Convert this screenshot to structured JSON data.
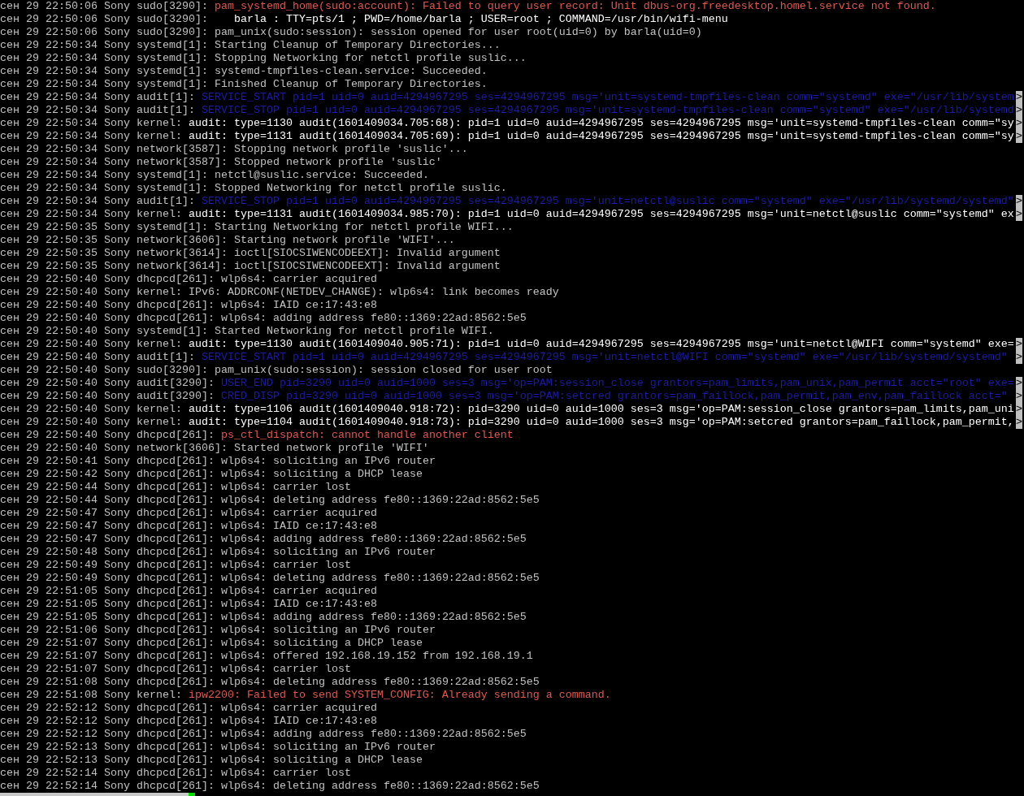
{
  "lines": [
    {
      "prefix": "сен 29 22:50:06 Sony sudo[3290]:",
      "message": "pam_systemd_home(sudo:account): Failed to query user record: Unit dbus-org.freedesktop.homel.service not found.",
      "kind": "error"
    },
    {
      "prefix": "сен 29 22:50:06 Sony sudo[3290]:",
      "message": "   barla : TTY=pts/1 ; PWD=/home/barla ; USER=root ; COMMAND=/usr/bin/wifi-menu",
      "kind": "notice"
    },
    {
      "prefix": "сен 29 22:50:06 Sony sudo[3290]:",
      "message": "pam_unix(sudo:session): session opened for user root(uid=0) by barla(uid=0)",
      "kind": "plain"
    },
    {
      "prefix": "сен 29 22:50:34 Sony systemd[1]:",
      "message": "Starting Cleanup of Temporary Directories...",
      "kind": "plain"
    },
    {
      "prefix": "сен 29 22:50:34 Sony systemd[1]:",
      "message": "Stopping Networking for netctl profile suslic...",
      "kind": "plain"
    },
    {
      "prefix": "сен 29 22:50:34 Sony systemd[1]:",
      "message": "systemd-tmpfiles-clean.service: Succeeded.",
      "kind": "plain"
    },
    {
      "prefix": "сен 29 22:50:34 Sony systemd[1]:",
      "message": "Finished Cleanup of Temporary Directories.",
      "kind": "plain"
    },
    {
      "prefix": "сен 29 22:50:34 Sony audit[1]:",
      "message": "SERVICE_START pid=1 uid=0 auid=4294967295 ses=4294967295 msg='unit=systemd-tmpfiles-clean comm=\"systemd\" exe=\"/usr/lib/system",
      "kind": "audit",
      "overflow": ">"
    },
    {
      "prefix": "сен 29 22:50:34 Sony audit[1]:",
      "message": "SERVICE_STOP pid=1 uid=0 auid=4294967295 ses=4294967295 msg='unit=systemd-tmpfiles-clean comm=\"systemd\" exe=\"/usr/lib/systemd",
      "kind": "audit",
      "overflow": ">"
    },
    {
      "prefix": "сен 29 22:50:34 Sony kernel:",
      "message": "audit: type=1130 audit(1601409034.705:68): pid=1 uid=0 auid=4294967295 ses=4294967295 msg='unit=systemd-tmpfiles-clean comm=\"sy",
      "kind": "notice",
      "overflow": ">"
    },
    {
      "prefix": "сен 29 22:50:34 Sony kernel:",
      "message": "audit: type=1131 audit(1601409034.705:69): pid=1 uid=0 auid=4294967295 ses=4294967295 msg='unit=systemd-tmpfiles-clean comm=\"sy",
      "kind": "notice",
      "overflow": ">"
    },
    {
      "prefix": "сен 29 22:50:34 Sony network[3587]:",
      "message": "Stopping network profile 'suslic'...",
      "kind": "plain"
    },
    {
      "prefix": "сен 29 22:50:34 Sony network[3587]:",
      "message": "Stopped network profile 'suslic'",
      "kind": "plain"
    },
    {
      "prefix": "сен 29 22:50:34 Sony systemd[1]:",
      "message": "netctl@suslic.service: Succeeded.",
      "kind": "plain"
    },
    {
      "prefix": "сен 29 22:50:34 Sony systemd[1]:",
      "message": "Stopped Networking for netctl profile suslic.",
      "kind": "plain"
    },
    {
      "prefix": "сен 29 22:50:34 Sony audit[1]:",
      "message": "SERVICE_STOP pid=1 uid=0 auid=4294967295 ses=4294967295 msg='unit=netctl@suslic comm=\"systemd\" exe=\"/usr/lib/systemd/systemd\"",
      "kind": "audit",
      "overflow": ">"
    },
    {
      "prefix": "сен 29 22:50:34 Sony kernel:",
      "message": "audit: type=1131 audit(1601409034.985:70): pid=1 uid=0 auid=4294967295 ses=4294967295 msg='unit=netctl@suslic comm=\"systemd\" ex",
      "kind": "notice",
      "overflow": ">"
    },
    {
      "prefix": "сен 29 22:50:35 Sony systemd[1]:",
      "message": "Starting Networking for netctl profile WIFI...",
      "kind": "plain"
    },
    {
      "prefix": "сен 29 22:50:35 Sony network[3606]:",
      "message": "Starting network profile 'WIFI'...",
      "kind": "plain"
    },
    {
      "prefix": "сен 29 22:50:35 Sony network[3614]:",
      "message": "ioctl[SIOCSIWENCODEEXT]: Invalid argument",
      "kind": "plain"
    },
    {
      "prefix": "сен 29 22:50:35 Sony network[3614]:",
      "message": "ioctl[SIOCSIWENCODEEXT]: Invalid argument",
      "kind": "plain"
    },
    {
      "prefix": "сен 29 22:50:40 Sony dhcpcd[261]:",
      "message": "wlp6s4: carrier acquired",
      "kind": "plain"
    },
    {
      "prefix": "сен 29 22:50:40 Sony kernel:",
      "message": "IPv6: ADDRCONF(NETDEV_CHANGE): wlp6s4: link becomes ready",
      "kind": "plain"
    },
    {
      "prefix": "сен 29 22:50:40 Sony dhcpcd[261]:",
      "message": "wlp6s4: IAID ce:17:43:e8",
      "kind": "plain"
    },
    {
      "prefix": "сен 29 22:50:40 Sony dhcpcd[261]:",
      "message": "wlp6s4: adding address fe80::1369:22ad:8562:5e5",
      "kind": "plain"
    },
    {
      "prefix": "сен 29 22:50:40 Sony systemd[1]:",
      "message": "Started Networking for netctl profile WIFI.",
      "kind": "plain"
    },
    {
      "prefix": "сен 29 22:50:40 Sony kernel:",
      "message": "audit: type=1130 audit(1601409040.905:71): pid=1 uid=0 auid=4294967295 ses=4294967295 msg='unit=netctl@WIFI comm=\"systemd\" exe=",
      "kind": "notice",
      "overflow": ">"
    },
    {
      "prefix": "сен 29 22:50:40 Sony audit[1]:",
      "message": "SERVICE_START pid=1 uid=0 auid=4294967295 ses=4294967295 msg='unit=netctl@WIFI comm=\"systemd\" exe=\"/usr/lib/systemd/systemd\"",
      "kind": "audit",
      "overflow": ">"
    },
    {
      "prefix": "сен 29 22:50:40 Sony sudo[3290]:",
      "message": "pam_unix(sudo:session): session closed for user root",
      "kind": "plain"
    },
    {
      "prefix": "сен 29 22:50:40 Sony audit[3290]:",
      "message": "USER_END pid=3290 uid=0 auid=1000 ses=3 msg='op=PAM:session_close grantors=pam_limits,pam_unix,pam_permit acct=\"root\" exe=",
      "kind": "audit",
      "overflow": ">"
    },
    {
      "prefix": "сен 29 22:50:40 Sony audit[3290]:",
      "message": "CRED_DISP pid=3290 uid=0 auid=1000 ses=3 msg='op=PAM:setcred grantors=pam_faillock,pam_permit,pam_env,pam_faillock acct=\"",
      "kind": "audit",
      "overflow": ">"
    },
    {
      "prefix": "сен 29 22:50:40 Sony kernel:",
      "message": "audit: type=1106 audit(1601409040.918:72): pid=3290 uid=0 auid=1000 ses=3 msg='op=PAM:session_close grantors=pam_limits,pam_uni",
      "kind": "notice",
      "overflow": ">"
    },
    {
      "prefix": "сен 29 22:50:40 Sony kernel:",
      "message": "audit: type=1104 audit(1601409040.918:73): pid=3290 uid=0 auid=1000 ses=3 msg='op=PAM:setcred grantors=pam_faillock,pam_permit,",
      "kind": "notice",
      "overflow": ">"
    },
    {
      "prefix": "сен 29 22:50:40 Sony dhcpcd[261]:",
      "message": "ps_ctl_dispatch: cannot handle another client",
      "kind": "error"
    },
    {
      "prefix": "сен 29 22:50:40 Sony network[3606]:",
      "message": "Started network profile 'WIFI'",
      "kind": "plain"
    },
    {
      "prefix": "сен 29 22:50:41 Sony dhcpcd[261]:",
      "message": "wlp6s4: soliciting an IPv6 router",
      "kind": "plain"
    },
    {
      "prefix": "сен 29 22:50:42 Sony dhcpcd[261]:",
      "message": "wlp6s4: soliciting a DHCP lease",
      "kind": "plain"
    },
    {
      "prefix": "сен 29 22:50:44 Sony dhcpcd[261]:",
      "message": "wlp6s4: carrier lost",
      "kind": "plain"
    },
    {
      "prefix": "сен 29 22:50:44 Sony dhcpcd[261]:",
      "message": "wlp6s4: deleting address fe80::1369:22ad:8562:5e5",
      "kind": "plain"
    },
    {
      "prefix": "сен 29 22:50:47 Sony dhcpcd[261]:",
      "message": "wlp6s4: carrier acquired",
      "kind": "plain"
    },
    {
      "prefix": "сен 29 22:50:47 Sony dhcpcd[261]:",
      "message": "wlp6s4: IAID ce:17:43:e8",
      "kind": "plain"
    },
    {
      "prefix": "сен 29 22:50:47 Sony dhcpcd[261]:",
      "message": "wlp6s4: adding address fe80::1369:22ad:8562:5e5",
      "kind": "plain"
    },
    {
      "prefix": "сен 29 22:50:48 Sony dhcpcd[261]:",
      "message": "wlp6s4: soliciting an IPv6 router",
      "kind": "plain"
    },
    {
      "prefix": "сен 29 22:50:49 Sony dhcpcd[261]:",
      "message": "wlp6s4: carrier lost",
      "kind": "plain"
    },
    {
      "prefix": "сен 29 22:50:49 Sony dhcpcd[261]:",
      "message": "wlp6s4: deleting address fe80::1369:22ad:8562:5e5",
      "kind": "plain"
    },
    {
      "prefix": "сен 29 22:51:05 Sony dhcpcd[261]:",
      "message": "wlp6s4: carrier acquired",
      "kind": "plain"
    },
    {
      "prefix": "сен 29 22:51:05 Sony dhcpcd[261]:",
      "message": "wlp6s4: IAID ce:17:43:e8",
      "kind": "plain"
    },
    {
      "prefix": "сен 29 22:51:05 Sony dhcpcd[261]:",
      "message": "wlp6s4: adding address fe80::1369:22ad:8562:5e5",
      "kind": "plain"
    },
    {
      "prefix": "сен 29 22:51:06 Sony dhcpcd[261]:",
      "message": "wlp6s4: soliciting an IPv6 router",
      "kind": "plain"
    },
    {
      "prefix": "сен 29 22:51:07 Sony dhcpcd[261]:",
      "message": "wlp6s4: soliciting a DHCP lease",
      "kind": "plain"
    },
    {
      "prefix": "сен 29 22:51:07 Sony dhcpcd[261]:",
      "message": "wlp6s4: offered 192.168.19.152 from 192.168.19.1",
      "kind": "plain"
    },
    {
      "prefix": "сен 29 22:51:07 Sony dhcpcd[261]:",
      "message": "wlp6s4: carrier lost",
      "kind": "plain"
    },
    {
      "prefix": "сен 29 22:51:08 Sony dhcpcd[261]:",
      "message": "wlp6s4: deleting address fe80::1369:22ad:8562:5e5",
      "kind": "plain"
    },
    {
      "prefix": "сен 29 22:51:08 Sony kernel:",
      "message": "ipw2200: Failed to send SYSTEM_CONFIG: Already sending a command.",
      "kind": "error"
    },
    {
      "prefix": "сен 29 22:52:12 Sony dhcpcd[261]:",
      "message": "wlp6s4: carrier acquired",
      "kind": "plain"
    },
    {
      "prefix": "сен 29 22:52:12 Sony dhcpcd[261]:",
      "message": "wlp6s4: IAID ce:17:43:e8",
      "kind": "plain"
    },
    {
      "prefix": "сен 29 22:52:12 Sony dhcpcd[261]:",
      "message": "wlp6s4: adding address fe80::1369:22ad:8562:5e5",
      "kind": "plain"
    },
    {
      "prefix": "сен 29 22:52:13 Sony dhcpcd[261]:",
      "message": "wlp6s4: soliciting an IPv6 router",
      "kind": "plain"
    },
    {
      "prefix": "сен 29 22:52:13 Sony dhcpcd[261]:",
      "message": "wlp6s4: soliciting a DHCP lease",
      "kind": "plain"
    },
    {
      "prefix": "сен 29 22:52:14 Sony dhcpcd[261]:",
      "message": "wlp6s4: carrier lost",
      "kind": "plain"
    },
    {
      "prefix": "сен 29 22:52:14 Sony dhcpcd[261]:",
      "message": "wlp6s4: deleting address fe80::1369:22ad:8562:5e5",
      "kind": "plain"
    }
  ]
}
